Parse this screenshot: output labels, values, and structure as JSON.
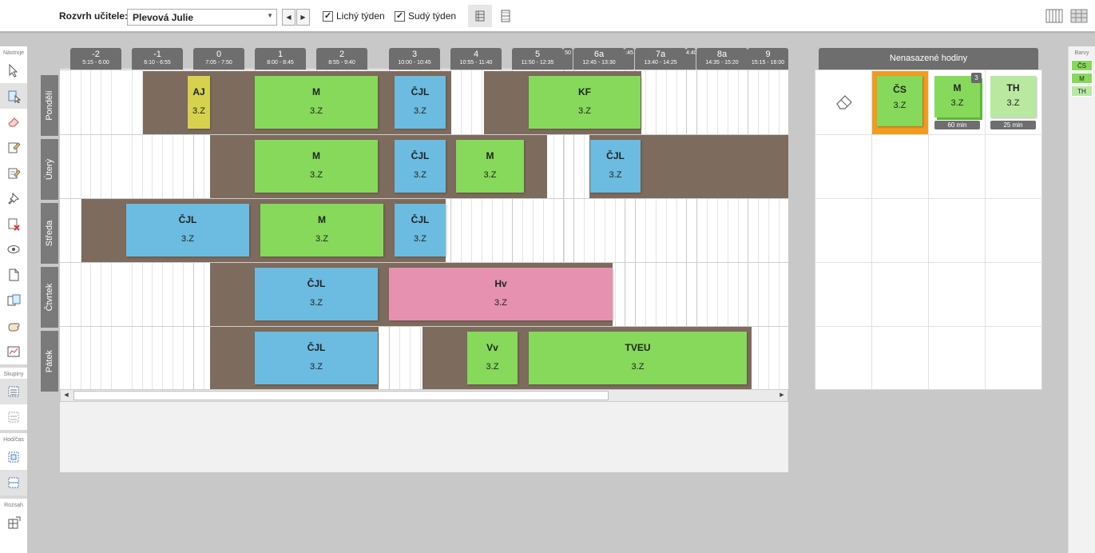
{
  "toolbar": {
    "teacher_label": "Rozvrh učitele:",
    "teacher_value": "Plevová Julie",
    "odd_week_label": "Lichý týden",
    "odd_week_checked": true,
    "even_week_label": "Sudý týden",
    "even_week_checked": true
  },
  "left_tools": {
    "section_tools": "Nástroje",
    "section_groups": "Skupiny",
    "section_hour_time": "Hod/čas",
    "section_range": "Rozsah"
  },
  "colors_panel": {
    "title": "Barvy",
    "items": [
      {
        "label": "ČS",
        "color": "#86d95a"
      },
      {
        "label": "M",
        "color": "#86d95a"
      },
      {
        "label": "TH",
        "color": "#b9e8a0"
      }
    ]
  },
  "periods": [
    {
      "num": "-2",
      "time": "5:15 - 6:00"
    },
    {
      "num": "-1",
      "time": "6:10 - 6:55"
    },
    {
      "num": "0",
      "time": "7:05 - 7:50"
    },
    {
      "num": "1",
      "time": "8:00 - 8:45"
    },
    {
      "num": "2",
      "time": "8:55 - 9:40"
    },
    {
      "num": "3",
      "time": "10:00 - 10:45"
    },
    {
      "num": "4",
      "time": "10:55 - 11:40"
    },
    {
      "num": "5",
      "time": "11:50 - 12:35"
    },
    {
      "num": "",
      "time": "50"
    },
    {
      "num": "6a",
      "time": "12:45 - 13:30"
    },
    {
      "num": "",
      "time": ":45"
    },
    {
      "num": "7a",
      "time": "13:40 - 14:25"
    },
    {
      "num": "",
      "time": "4:40"
    },
    {
      "num": "8a",
      "time": "14:35 - 15:20"
    },
    {
      "num": "9",
      "time": "15:15 - 16:00"
    }
  ],
  "days": [
    "Pondělí",
    "Úterý",
    "Středa",
    "Čtvrtek",
    "Pátek"
  ],
  "lessons": [
    {
      "subject": "AJ",
      "class": "3.Z",
      "color": "#d6d24f"
    },
    {
      "subject": "M",
      "class": "3.Z",
      "color": "#86d95a"
    },
    {
      "subject": "ČJL",
      "class": "3.Z",
      "color": "#6cbbe0"
    },
    {
      "subject": "KF",
      "class": "3.Z",
      "color": "#86d95a"
    },
    {
      "subject": "M",
      "class": "3.Z",
      "color": "#86d95a"
    },
    {
      "subject": "ČJL",
      "class": "3.Z",
      "color": "#6cbbe0"
    },
    {
      "subject": "M",
      "class": "3.Z",
      "color": "#86d95a"
    },
    {
      "subject": "ČJL",
      "class": "3.Z",
      "color": "#6cbbe0"
    },
    {
      "subject": "ČJL",
      "class": "3.Z",
      "color": "#6cbbe0"
    },
    {
      "subject": "M",
      "class": "3.Z",
      "color": "#86d95a"
    },
    {
      "subject": "ČJL",
      "class": "3.Z",
      "color": "#6cbbe0"
    },
    {
      "subject": "ČJL",
      "class": "3.Z",
      "color": "#6cbbe0"
    },
    {
      "subject": "Hv",
      "class": "3.Z",
      "color": "#e691b0"
    },
    {
      "subject": "ČJL",
      "class": "3.Z",
      "color": "#6cbbe0"
    },
    {
      "subject": "Vv",
      "class": "3.Z",
      "color": "#86d95a"
    },
    {
      "subject": "TVEU",
      "class": "3.Z",
      "color": "#86d95a"
    }
  ],
  "unassigned": {
    "title": "Nenasazené hodiny",
    "cards": [
      {
        "subject": "ČS",
        "class": "3.Z",
        "color": "#86d95a",
        "selected": true
      },
      {
        "subject": "M",
        "class": "3.Z",
        "color": "#86d95a",
        "count": "3",
        "duration": "60 min"
      },
      {
        "subject": "TH",
        "class": "3.Z",
        "color": "#b9e8a0",
        "duration": "25 min"
      }
    ]
  }
}
